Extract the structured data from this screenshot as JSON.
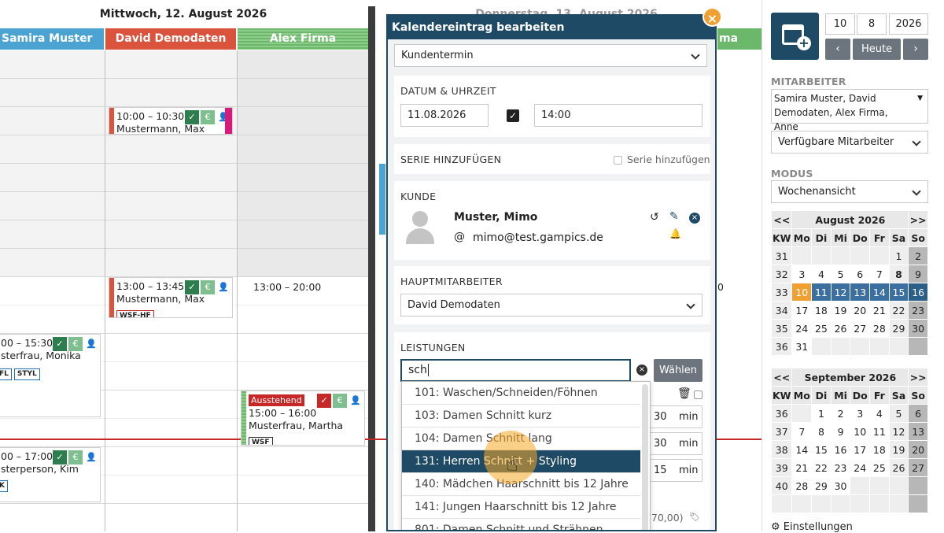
{
  "calendar": {
    "day_title": "Mittwoch, 12. August 2026",
    "day_title_right": "Donnerstag, 13. August 2026",
    "columns": [
      {
        "name": "Samira Muster",
        "color": "#4aa3d0"
      },
      {
        "name": "David Demodaten",
        "color": "#d9533d"
      },
      {
        "name": "Alex Firma",
        "color": "#6cb86a"
      }
    ],
    "right_col_fragment": "ma",
    "right_time_fragment": "0",
    "appointments": [
      {
        "time": "10:00 – 10:30",
        "name": "Mustermann, Max"
      },
      {
        "time": "13:00 – 13:45",
        "name": "Mustermann, Max",
        "tag": "WSF-HF"
      },
      {
        "time": "13:00 – 20:00"
      },
      {
        "time": "00 – 15:30",
        "name": "sterfrau, Monika",
        "tags": [
          "FL",
          "STYL"
        ]
      },
      {
        "status": "Ausstehend",
        "time": "15:00 – 16:00",
        "name": "Musterfrau, Martha",
        "tag": "WSF"
      },
      {
        "time": "00 – 17:00",
        "name": "sterperson, Kim",
        "tag": "K"
      }
    ]
  },
  "dialog": {
    "title": "Kalendereintrag bearbeiten",
    "type_select": "Kundentermin",
    "date_section": "DATUM & UHRZEIT",
    "date_value": "11.08.2026",
    "time_value": "14:00",
    "series_section": "SERIE HINZUFÜGEN",
    "series_checkbox_label": "Serie hinzufügen",
    "customer_section": "KUNDE",
    "customer_name": "Muster, Mimo",
    "customer_email": "mimo@test.gampics.de",
    "main_employee_section": "HAUPTMITARBEITER",
    "main_employee": "David Demodaten",
    "services_section": "LEISTUNGEN",
    "services_search": "sch",
    "choose_button": "Wählen",
    "dropdown_items": [
      "101: Waschen/Schneiden/Föhnen",
      "103: Damen Schnitt kurz",
      "104: Damen Schnitt lang",
      "131: Herren Schnitt + Styling",
      "140: Mädchen Haarschnitt bis 12 Jahre",
      "141: Jungen Haarschnitt bis 12 Jahre",
      "801: Damen Schnitt und Strähnen"
    ],
    "selected_index": 3,
    "durations": [
      "30",
      "30",
      "15"
    ],
    "duration_unit": "min",
    "price_fragment": "(70,00)"
  },
  "panel": {
    "day": "10",
    "month": "8",
    "year": "2026",
    "today_button": "Heute",
    "employees_label": "MITARBEITER",
    "employees_value": "Samira Muster, David Demodaten, Alex Firma, Anne",
    "available_select": "Verfügbare Mitarbeiter",
    "mode_label": "MODUS",
    "mode_select": "Wochenansicht",
    "settings_label": "Einstellungen",
    "august": {
      "title": "August 2026",
      "prev": "<<",
      "next": ">>",
      "headers": [
        "KW",
        "Mo",
        "Di",
        "Mi",
        "Do",
        "Fr",
        "Sa",
        "So"
      ],
      "rows": [
        [
          "31",
          "",
          "",
          "",
          "",
          "",
          "1",
          "2"
        ],
        [
          "32",
          "3",
          "4",
          "5",
          "6",
          "7",
          "8",
          "9"
        ],
        [
          "33",
          "10",
          "11",
          "12",
          "13",
          "14",
          "15",
          "16"
        ],
        [
          "34",
          "17",
          "18",
          "19",
          "20",
          "21",
          "22",
          "23"
        ],
        [
          "35",
          "24",
          "25",
          "26",
          "27",
          "28",
          "29",
          "30"
        ],
        [
          "36",
          "31",
          "",
          "",
          "",
          "",
          "",
          ""
        ]
      ]
    },
    "september": {
      "title": "September 2026",
      "prev": "<<",
      "next": ">>",
      "headers": [
        "KW",
        "Mo",
        "Di",
        "Mi",
        "Do",
        "Fr",
        "Sa",
        "So"
      ],
      "rows": [
        [
          "36",
          "",
          "1",
          "2",
          "3",
          "4",
          "5",
          "6"
        ],
        [
          "37",
          "7",
          "8",
          "9",
          "10",
          "11",
          "12",
          "13"
        ],
        [
          "38",
          "14",
          "15",
          "16",
          "17",
          "18",
          "19",
          "20"
        ],
        [
          "39",
          "21",
          "22",
          "23",
          "24",
          "25",
          "26",
          "27"
        ],
        [
          "40",
          "28",
          "29",
          "30",
          "",
          "",
          "",
          ""
        ],
        [
          "",
          "",
          "",
          "",
          "",
          "",
          "",
          ""
        ]
      ]
    },
    "colors": {
      "accent": "#1f4a66",
      "today": "#f0a030",
      "week": "#3b6fa0"
    }
  }
}
